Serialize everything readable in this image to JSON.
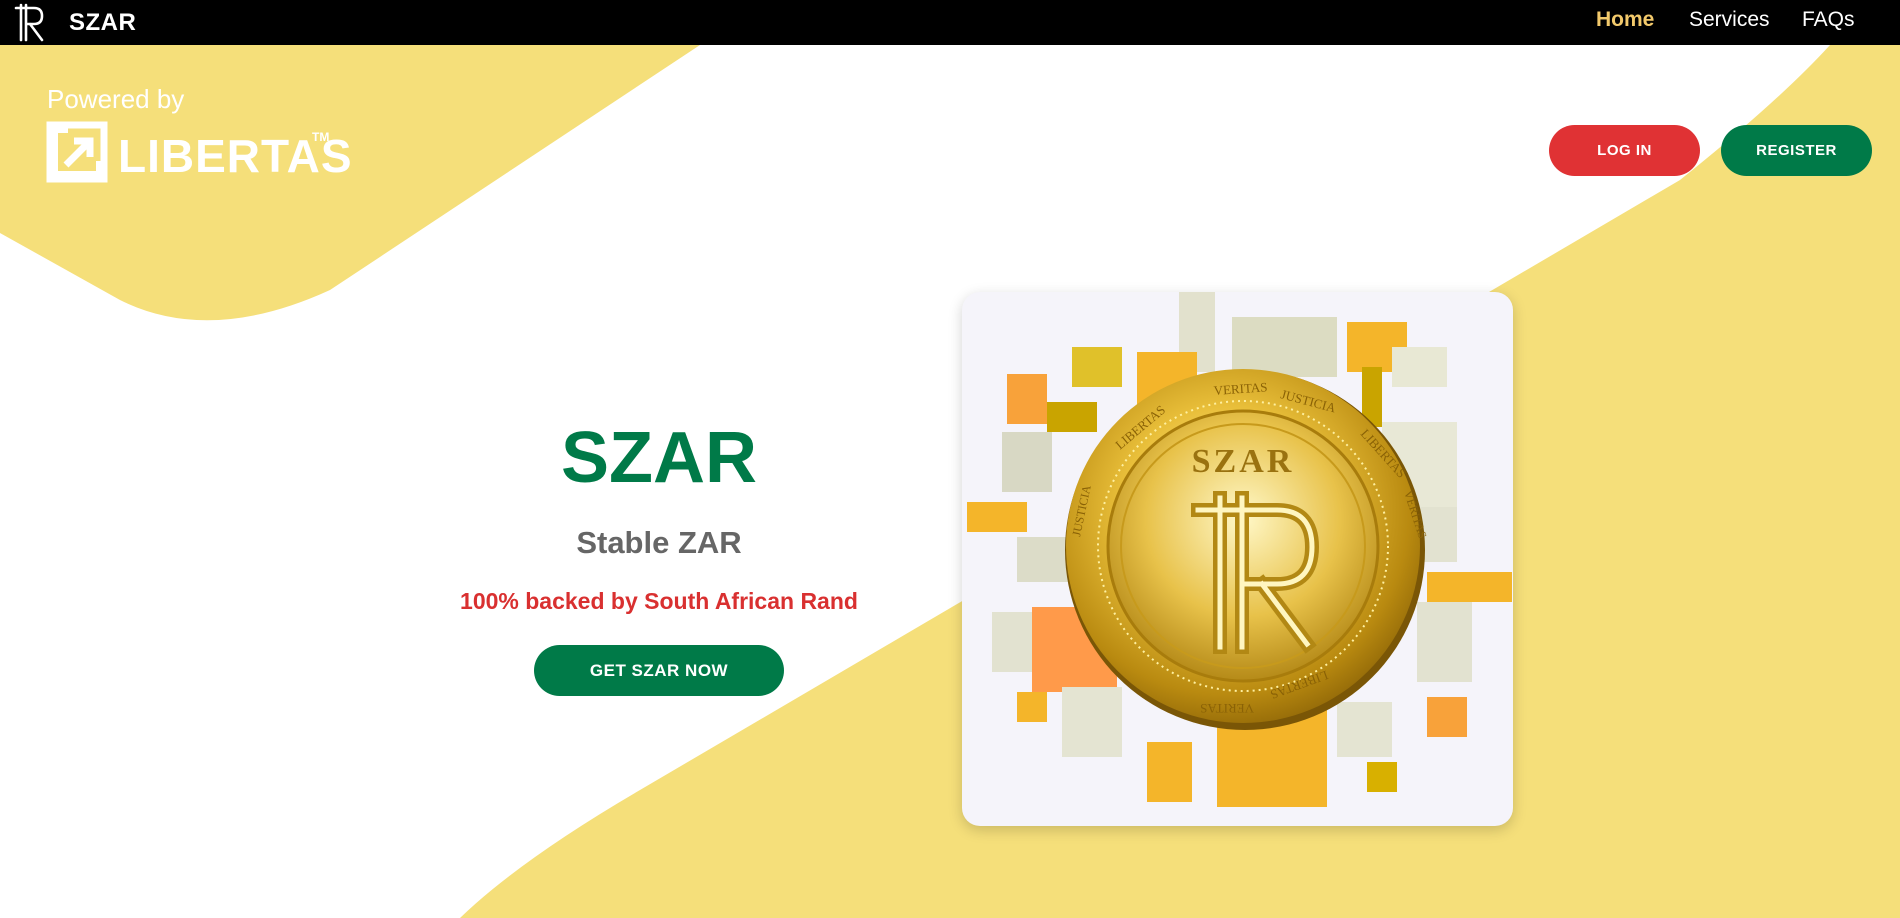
{
  "app": {
    "brand_name": "SZAR",
    "brand_icon": "rand-symbol-icon"
  },
  "nav": {
    "items": [
      {
        "label": "Home",
        "active": true
      },
      {
        "label": "Services",
        "active": false
      },
      {
        "label": "FAQs",
        "active": false
      }
    ]
  },
  "powered_by": {
    "label": "Powered by",
    "logo_word": "LIBERTAS",
    "logo_tm": "TM",
    "logo_icon": "arrow-box-icon"
  },
  "auth": {
    "login_label": "LOG IN",
    "register_label": "REGISTER"
  },
  "hero": {
    "title": "SZAR",
    "subtitle": "Stable ZAR",
    "tagline": "100% backed by South African Rand",
    "cta_label": "GET SZAR NOW"
  },
  "coin": {
    "center_text": "SZAR",
    "ring_words": [
      "VERITAS",
      "JUSTICIA",
      "LIBERTAS",
      "VERITAS",
      "LIBERTAS",
      "VERITAS",
      "JUSTICIA",
      "LIBERTAS"
    ],
    "symbol_icon": "rand-symbol-icon"
  },
  "colors": {
    "accent_yellow": "#f5df7a",
    "brand_green": "#007a48",
    "brand_red": "#e03234",
    "nav_active": "#f2c96b",
    "topbar": "#000000"
  }
}
